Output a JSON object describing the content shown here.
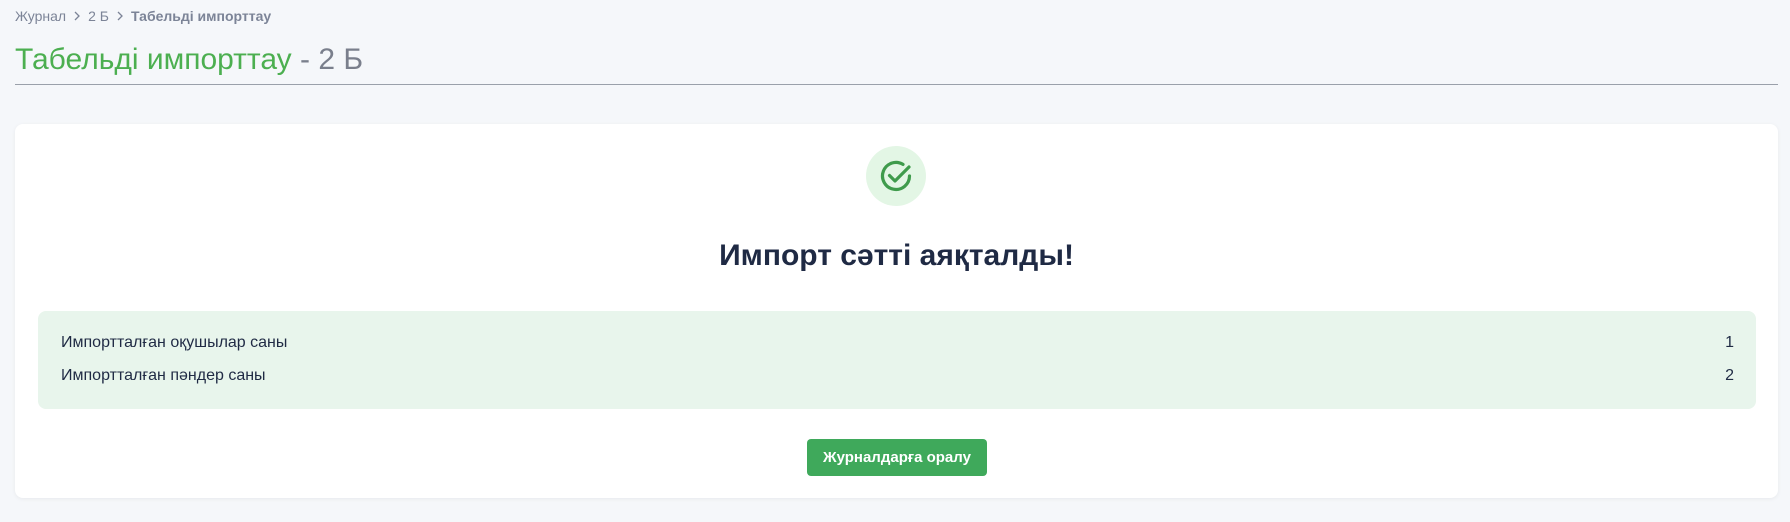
{
  "breadcrumb": {
    "items": [
      "Журнал",
      "2 Б"
    ],
    "current": "Табельді импорттау"
  },
  "header": {
    "title": "Табельді импорттау",
    "subtitle": "- 2 Б"
  },
  "result": {
    "icon": "check-circle-icon",
    "title": "Импорт сәтті аяқталды!",
    "stats": [
      {
        "label": "Импортталған оқушылар саны",
        "value": "1"
      },
      {
        "label": "Импортталған пәндер саны",
        "value": "2"
      }
    ]
  },
  "actions": {
    "back_label": "Журналдарға оралу"
  },
  "colors": {
    "accent": "#4caf50",
    "button": "#3fa95b",
    "stats_bg": "#e8f5ec",
    "badge_bg": "#e3f6e5"
  }
}
